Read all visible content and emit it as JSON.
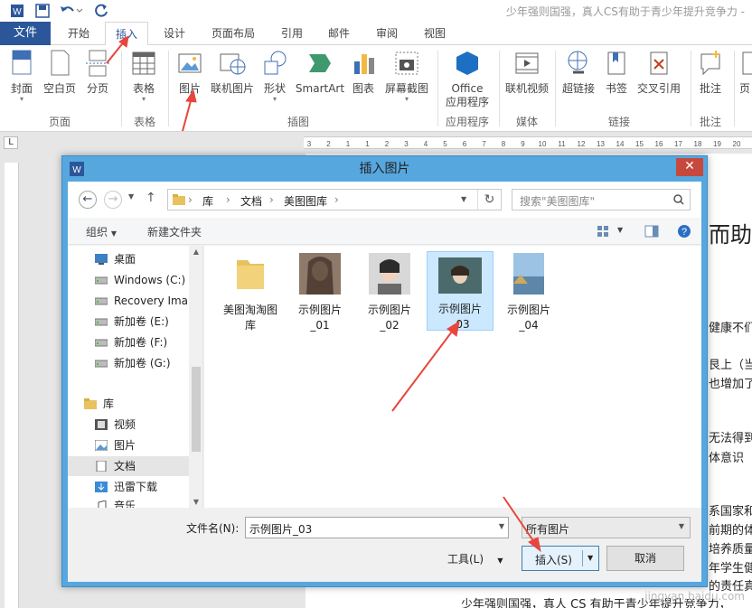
{
  "window": {
    "title": "少年强则国强，真人CS有助于青少年提升竞争力 -"
  },
  "tabs": [
    {
      "label": "文件"
    },
    {
      "label": "开始"
    },
    {
      "label": "插入"
    },
    {
      "label": "设计"
    },
    {
      "label": "页面布局"
    },
    {
      "label": "引用"
    },
    {
      "label": "邮件"
    },
    {
      "label": "审阅"
    },
    {
      "label": "视图"
    }
  ],
  "ribbon": {
    "buttons": [
      "封面",
      "空白页",
      "分页",
      "表格",
      "图片",
      "联机图片",
      "形状",
      "SmartArt",
      "图表",
      "屏幕截图",
      "Office\n应用程序",
      "联机视频",
      "超链接",
      "书签",
      "交叉引用",
      "批注",
      "页"
    ],
    "groups": [
      "页面",
      "表格",
      "插图",
      "应用程序",
      "媒体",
      "链接",
      "批注"
    ]
  },
  "ruler": {
    "corner": "L",
    "ticks": [
      "3",
      "2",
      "1",
      "1",
      "2",
      "3",
      "4",
      "5",
      "6",
      "7",
      "8",
      "9",
      "10",
      "11",
      "12",
      "13",
      "14",
      "15",
      "16",
      "17",
      "18",
      "19",
      "20"
    ]
  },
  "document": {
    "fragments": [
      "而助于",
      "健康不们",
      "艮上（当",
      "也增加了",
      "无法得到",
      "体意识",
      "系国家和",
      "前期的体",
      "培养质量",
      "年学生健",
      "的责任真",
      "少年强则国强，真人 CS 有助于青少年提升竞争力，"
    ]
  },
  "dialog": {
    "title": "插入图片",
    "close_glyph": "✕",
    "breadcrumb": [
      "库",
      "文档",
      "美图图库"
    ],
    "search_placeholder": "搜索\"美图图库\"",
    "organize": "组织",
    "new_folder": "新建文件夹",
    "nav": [
      {
        "label": "桌面",
        "icon": "desktop-icon"
      },
      {
        "label": "Windows (C:)",
        "icon": "drive-icon"
      },
      {
        "label": "Recovery Ima",
        "icon": "drive-icon"
      },
      {
        "label": "新加卷 (E:)",
        "icon": "drive-icon"
      },
      {
        "label": "新加卷 (F:)",
        "icon": "drive-icon"
      },
      {
        "label": "新加卷 (G:)",
        "icon": "drive-icon"
      },
      {
        "label": "库",
        "icon": "library-icon"
      },
      {
        "label": "视频",
        "icon": "video-icon"
      },
      {
        "label": "图片",
        "icon": "picture-icon"
      },
      {
        "label": "文档",
        "icon": "document-icon"
      },
      {
        "label": "迅雷下载",
        "icon": "download-icon"
      },
      {
        "label": "音乐",
        "icon": "music-icon"
      }
    ],
    "files": [
      {
        "label": "美图淘淘图\n库",
        "type": "folder"
      },
      {
        "label": "示例图片\n_01",
        "type": "image"
      },
      {
        "label": "示例图片\n_02",
        "type": "image"
      },
      {
        "label": "示例图片\n_03",
        "type": "image"
      },
      {
        "label": "示例图片\n_04",
        "type": "image"
      }
    ],
    "filename_label": "文件名(N):",
    "filename_value": "示例图片_03",
    "filetype": "所有图片",
    "tools": "工具(L)",
    "insert": "插入(S)",
    "cancel": "取消"
  },
  "watermark": "jingyan.baidu.com",
  "colors": {
    "accent": "#2b579a",
    "dialog_frame": "#56a7de",
    "arrow": "#e8453c",
    "selection": "#cce8ff"
  }
}
